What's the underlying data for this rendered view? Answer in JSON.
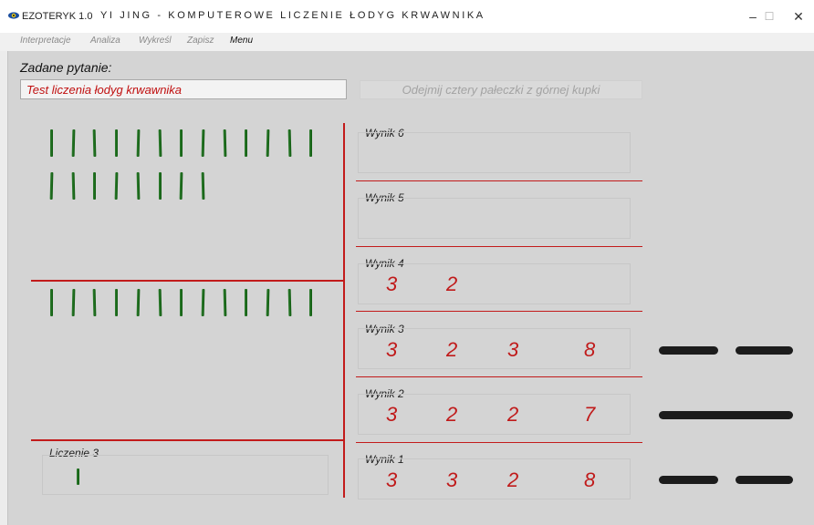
{
  "window": {
    "app_name": "EZOTERYK 1.0",
    "title": "YI JING - KOMPUTEROWE LICZENIE ŁODYG KRWAWNIKA",
    "controls": [
      "–",
      "☐",
      "✕"
    ]
  },
  "menu": [
    "Interpretacje",
    "Analiza",
    "Wykreśl",
    "Zapisz",
    "Menu"
  ],
  "question": {
    "label": "Zadane pytanie:",
    "value": "Test liczenia łodyg krwawnika"
  },
  "action_button": "Odejmij cztery pałeczki z górnej kupki",
  "piles": {
    "top_count": 21,
    "middle_count": 13,
    "counting_count": 1
  },
  "counting": {
    "label": "Liczenie 3"
  },
  "results": [
    {
      "label": "Wynik 6",
      "values": []
    },
    {
      "label": "Wynik 5",
      "values": []
    },
    {
      "label": "Wynik 4",
      "values": [
        "3",
        "2"
      ]
    },
    {
      "label": "Wynik 3",
      "values": [
        "3",
        "2",
        "3",
        "8"
      ]
    },
    {
      "label": "Wynik 2",
      "values": [
        "3",
        "2",
        "2",
        "7"
      ]
    },
    {
      "label": "Wynik 1",
      "values": [
        "3",
        "3",
        "2",
        "8"
      ]
    }
  ],
  "hexagram_lines": [
    {
      "result": "Wynik 3",
      "type": "broken"
    },
    {
      "result": "Wynik 2",
      "type": "solid"
    },
    {
      "result": "Wynik 1",
      "type": "broken"
    }
  ],
  "colors": {
    "accent_red": "#c21b1b",
    "stick_green": "#1f6e1f",
    "line_black": "#1c1c1c"
  }
}
